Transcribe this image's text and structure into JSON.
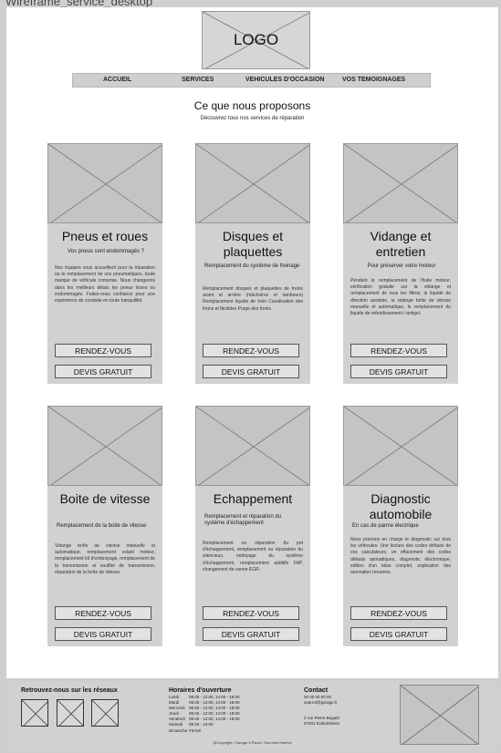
{
  "frame_title": "Wireframe_service_desktop",
  "header": {
    "logo_text": "LOGO"
  },
  "nav": {
    "items": [
      {
        "label": "ACCUEIL"
      },
      {
        "label": "SERVICES"
      },
      {
        "label": "VEHICULES D'OCCASION"
      },
      {
        "label": "VOS TEMOIGNAGES"
      }
    ]
  },
  "intro": {
    "title": "Ce que nous proposons",
    "subtitle": "Découvrez tous nos services de réparation"
  },
  "cards": [
    {
      "title": "Pneus et roues",
      "subtitle": "Vos pneus sont endommagés ?",
      "description": "Nos équipes vous accueillent pour la réparation ou le remplacement de vos pneumatiques, toute marque de véhicule comprise. Nous changeons dans les meilleurs délais les pneus lisses ou endommagés. Faites-nous confiance pour une expérience de conduite en toute tranquillité.",
      "btn_appointment": "RENDEZ-VOUS",
      "btn_quote": "DEVIS GRATUIT"
    },
    {
      "title": "Disques et plaquettes",
      "subtitle": "Remplacement du système de freinage",
      "description": "Remplacement disques et plaquettes de freins avant et arrière (mâchoires et tambours) Remplacement liquide de frein Canalisation des freins et flexibles Purge des freins",
      "btn_appointment": "RENDEZ-VOUS",
      "btn_quote": "DEVIS GRATUIT"
    },
    {
      "title": "Vidange et entretien",
      "subtitle": "Pour préserver votre moteur",
      "description": "Pendant le remplacement de l'huile moteur, vérification gratuite sur la vidange et remplacement de tous les filtres, le liquide de direction assistée, la vidange boîte de vitesse manuelle et automatique, le remplacement du liquide de refroidissement / antigel.",
      "btn_appointment": "RENDEZ-VOUS",
      "btn_quote": "DEVIS GRATUIT"
    },
    {
      "title": "Boite de vitesse",
      "subtitle": "Remplacement de la boite de vitesse",
      "description": "Vidange boîte de vitesse manuelle et automatique, remplacement volant moteur, remplacement kit d'embrayage, remplacement de la transmission et soufflet de transmission, réparation de la boîte de vitesse.",
      "btn_appointment": "RENDEZ-VOUS",
      "btn_quote": "DEVIS GRATUIT"
    },
    {
      "title": "Echappement",
      "subtitle": "Remplacement et réparation du système d'échappement",
      "description": "Remplacement ou réparation du pot d'échappement, remplacement ou réparation du silencieux, nettoyage du système d'échappement, remplacement additifs FAP, changement de vanne EGR.",
      "btn_appointment": "RENDEZ-VOUS",
      "btn_quote": "DEVIS GRATUIT"
    },
    {
      "title": "Diagnostic automobile",
      "subtitle": "En cas de panne électrique",
      "description": "Nous prenons en charge le diagnostic sur tous les véhicules. Une lecture des codes défauts de vos calculateurs, un effacement des codes défauts sporadiques, diagnostic électronique, edition d'un bilan complet, explication des anomalies trouvées.",
      "btn_appointment": "RENDEZ-VOUS",
      "btn_quote": "DEVIS GRATUIT"
    }
  ],
  "footer": {
    "social_heading": "Retrouvez-nous sur les réseaux",
    "hours_heading": "Horaires d'ouverture",
    "hours": [
      {
        "day": "Lundi",
        "time": "08:45 - 12:00, 14:00 - 18:00"
      },
      {
        "day": "Mardi",
        "time": "08:45 - 12:00, 14:00 - 18:00"
      },
      {
        "day": "Mercredi",
        "time": "08:45 - 12:00, 14:00 - 18:00"
      },
      {
        "day": "Jeudi",
        "time": "08:45 - 12:00, 14:00 - 18:00"
      },
      {
        "day": "Vendredi",
        "time": "08:45 - 12:00, 14:00 - 18:00"
      },
      {
        "day": "Samedi",
        "time": "08:45 - 12:00"
      },
      {
        "day": "Dimanche",
        "time": "Fermé"
      }
    ],
    "contact_heading": "Contact",
    "phone": "00 00 00 00 00",
    "email": "vparrot@garage.fr",
    "address_line1": "2 rue Pierre Bugatti",
    "address_line2": "67201 Eckbolsheim",
    "copyright": "@Copyright | Garage V.Parrot. Tout droit réservé"
  }
}
